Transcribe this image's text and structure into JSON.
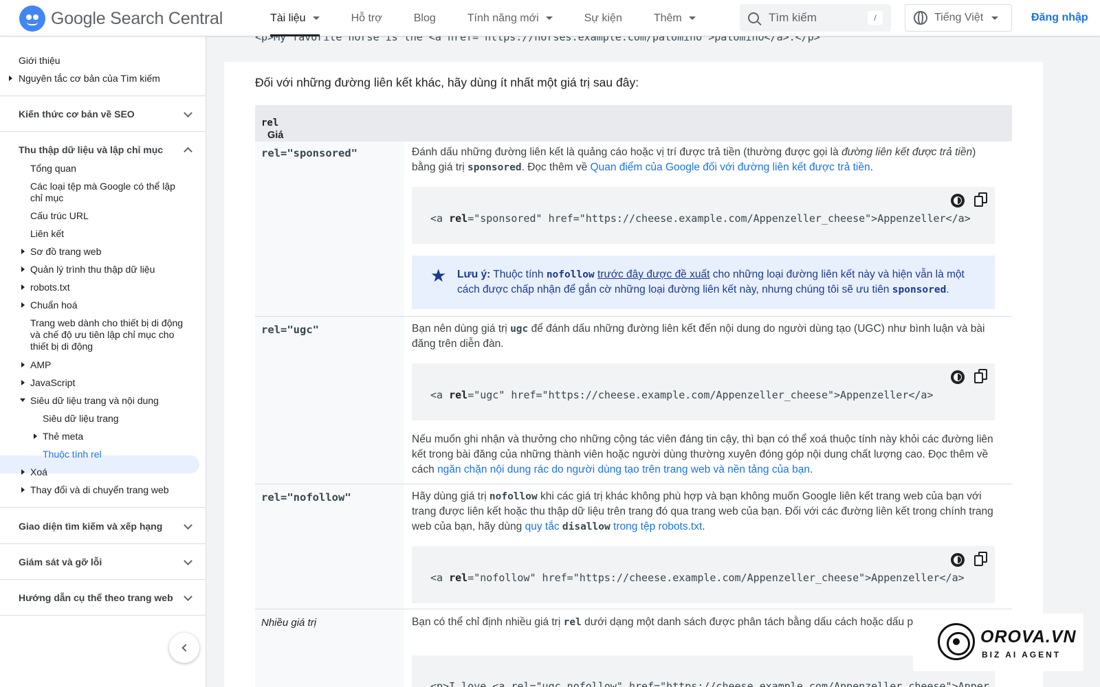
{
  "header": {
    "brand": "Google Search Central",
    "nav": [
      {
        "label": "Tài liệu",
        "dropdown": true
      },
      {
        "label": "Hỗ trợ",
        "dropdown": false
      },
      {
        "label": "Blog",
        "dropdown": false
      },
      {
        "label": "Tính năng mới",
        "dropdown": true
      },
      {
        "label": "Sự kiện",
        "dropdown": false
      },
      {
        "label": "Thêm",
        "dropdown": true
      }
    ],
    "search_placeholder": "Tìm kiếm",
    "search_shortcut": "/",
    "language": "Tiếng Việt",
    "signin": "Đăng nhập"
  },
  "sidebar": {
    "intro": "Giới thiệu",
    "basics": "Nguyên tắc cơ bản của Tìm kiếm",
    "section_seo": "Kiến thức cơ bản về SEO",
    "section_crawl": "Thu thập dữ liệu và lập chỉ mục",
    "items": [
      "Tổng quan",
      "Các loại tệp mà Google có thể lập chỉ mục",
      "Cấu trúc URL",
      "Liên kết",
      "Sơ đồ trang web",
      "Quản lý trình thu thập dữ liệu",
      "robots.txt",
      "Chuẩn hoá",
      "Trang web dành cho thiết bị di động và chế độ ưu tiên lập chỉ mục cho thiết bị di động",
      "AMP",
      "JavaScript",
      "Siêu dữ liệu trang và nội dung",
      "Siêu dữ liệu trang",
      "Thẻ meta",
      "Thuộc tính rel",
      "Xoá",
      "Thay đổi và di chuyển trang web"
    ],
    "section_appearance": "Giao diện tìm kiếm và xếp hạng",
    "section_monitor": "Giám sát và gỡ lỗi",
    "section_guides": "Hướng dẫn cụ thể theo trang web"
  },
  "content": {
    "top_code": "<p>My favorite horse is the <a href=\"https://horses.example.com/palomino\">palomino</a>.</p>",
    "intro": "Đối với những đường liên kết khác, hãy dùng ít nhất một giá trị sau đây:",
    "table_header_label": "Giá trị",
    "table_header_code": "rel",
    "rows": {
      "sponsored": {
        "key": "rel=\"sponsored\"",
        "text_1": "Đánh dấu những đường liên kết là quảng cáo hoặc vị trí được trả tiền (thường được gọi là ",
        "text_em": "đường liên kết được trả tiền",
        "text_2": ") bằng giá trị ",
        "text_code": "sponsored",
        "text_3": ". Đọc thêm về ",
        "link": "Quan điểm của Google đối với đường liên kết được trả tiền",
        "text_4": ".",
        "code_pre": "<a ",
        "code_attr": "rel",
        "code_post": "=\"sponsored\" href=\"https://cheese.example.com/Appenzeller_cheese\">Appenzeller</a>",
        "note_label": "Lưu ý:",
        "note_1": " Thuộc tính ",
        "note_code": "nofollow",
        "note_link": "trước đây được đề xuất",
        "note_2": " cho những loại đường liên kết này và hiện vẫn là một cách được chấp nhận để gắn cờ những loại đường liên kết này, nhưng chúng tôi sẽ ưu tiên ",
        "note_code2": "sponsored",
        "note_3": "."
      },
      "ugc": {
        "key": "rel=\"ugc\"",
        "text_1": "Bạn nên dùng giá trị ",
        "text_code": "ugc",
        "text_2": " để đánh dấu những đường liên kết đến nội dung do người dùng tạo (UGC) như bình luận và bài đăng trên diễn đàn.",
        "code_pre": "<a ",
        "code_attr": "rel",
        "code_post": "=\"ugc\" href=\"https://cheese.example.com/Appenzeller_cheese\">Appenzeller</a>",
        "after_1": "Nếu muốn ghi nhận và thưởng cho những cộng tác viên đáng tin cậy, thì bạn có thể xoá thuộc tính này khỏi các đường liên kết trong bài đăng của những thành viên hoặc người dùng thường xuyên đóng góp nội dung chất lượng cao. Đọc thêm về cách ",
        "after_link": "ngăn chặn nội dung rác do người dùng tạo trên trang web và nền tảng của bạn",
        "after_2": "."
      },
      "nofollow": {
        "key": "rel=\"nofollow\"",
        "text_1": "Hãy dùng giá trị ",
        "text_code": "nofollow",
        "text_2": " khi các giá trị khác không phù hợp và bạn không muốn Google liên kết trang web của bạn với trang được liên kết hoặc thu thập dữ liệu trên trang đó qua trang web của bạn. Đối với các đường liên kết trong chính trang web của bạn, hãy dùng ",
        "link_1": "quy tắc ",
        "link_code": "disallow",
        "link_2": " trong tệp robots.txt",
        "text_3": ".",
        "code_pre": "<a ",
        "code_attr": "rel",
        "code_post": "=\"nofollow\" href=\"https://cheese.example.com/Appenzeller_cheese\">Appenzeller</a>"
      },
      "multi": {
        "key": "Nhiều giá trị",
        "text_1": "Bạn có thể chỉ định nhiều giá trị ",
        "text_code": "rel",
        "text_2": " dưới dạng một danh sách được phân tách bằng dấu cách hoặc dấu p",
        "code_partial": "<p>I love <a rel=\"ugc nofollow\" href=\"https://cheese.example.com/Appenzeller_cheese\">Apper"
      }
    }
  },
  "watermark": {
    "title": "OROVA.VN",
    "subtitle": "BIZ AI AGENT"
  },
  "colors": {
    "accent": "#1a73e8",
    "note_bg": "#e8f0fe",
    "note_text": "#1a3a8f",
    "code_bg": "#f1f3f4"
  }
}
